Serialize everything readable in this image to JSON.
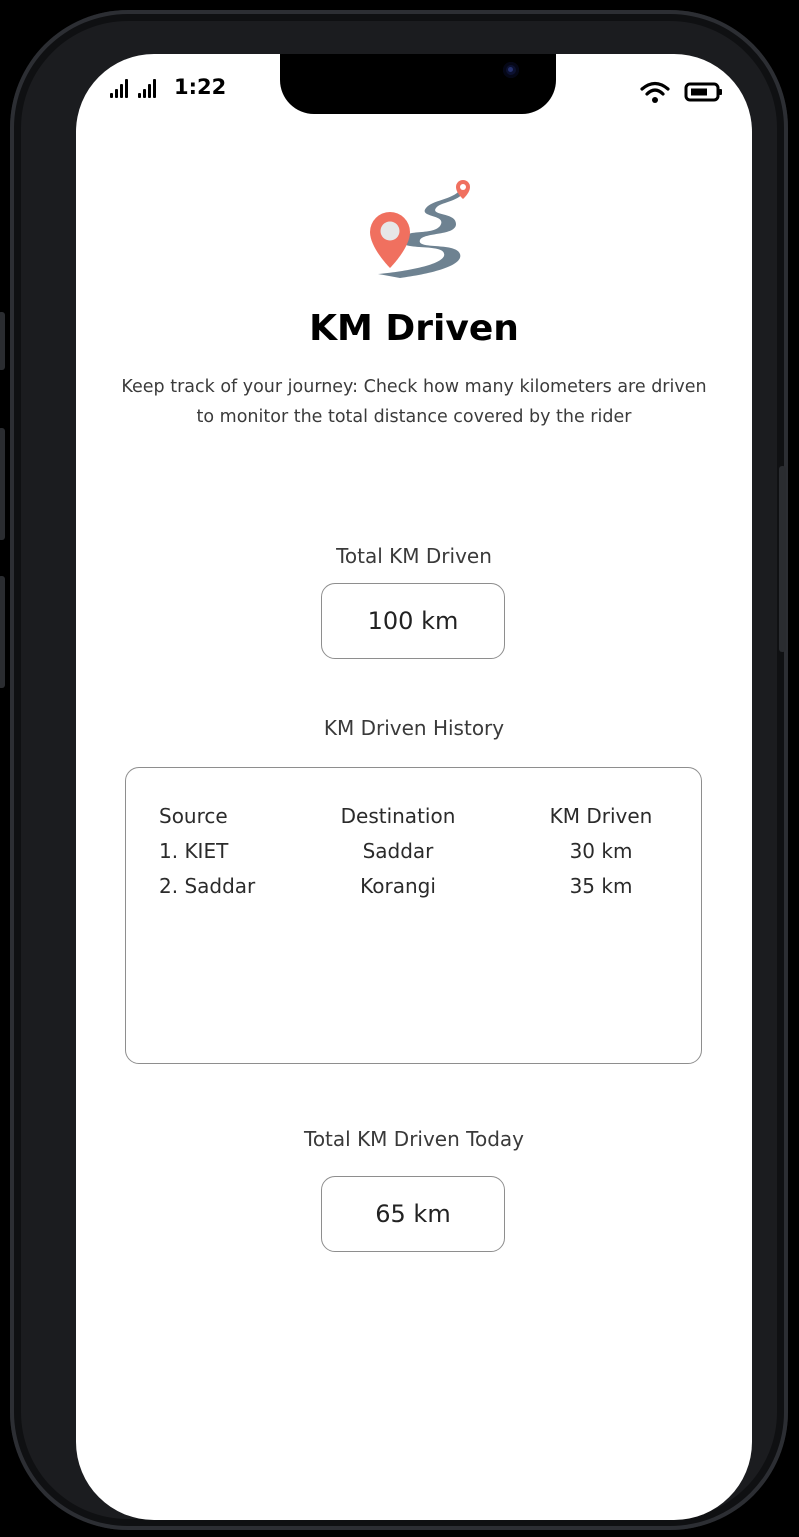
{
  "status_bar": {
    "time": "1:22"
  },
  "header": {
    "title": "KM Driven",
    "description": "Keep track of your journey: Check how many kilometers are driven to monitor the total distance covered by the rider"
  },
  "total": {
    "label": "Total KM Driven",
    "value": "100 km"
  },
  "history": {
    "label": "KM Driven History",
    "columns": [
      "Source",
      "Destination",
      "KM Driven"
    ],
    "rows": [
      {
        "source": "1. KIET",
        "destination": "Saddar",
        "km": "30 km"
      },
      {
        "source": "2. Saddar",
        "destination": "Korangi",
        "km": "35 km"
      }
    ]
  },
  "today": {
    "label": "Total KM Driven Today",
    "value": "65 km"
  },
  "icons": [
    "signal-icon",
    "wifi-icon",
    "battery-icon",
    "route-map-pin-icon"
  ],
  "colors": {
    "pin": "#F0705F",
    "road": "#6E8291"
  }
}
